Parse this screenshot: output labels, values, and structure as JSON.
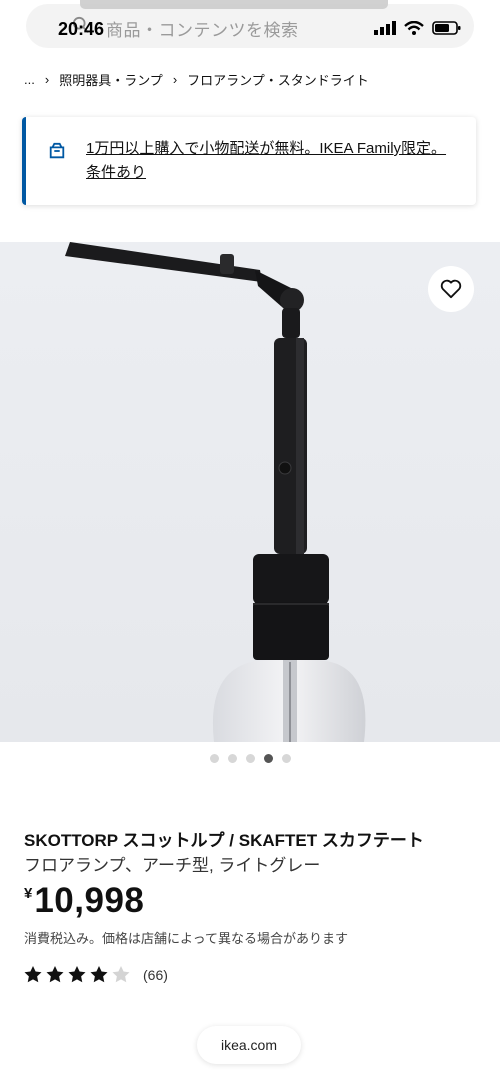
{
  "status_bar": {
    "time": "20:46"
  },
  "search": {
    "placeholder": "商品・コンテンツを検索"
  },
  "breadcrumb": {
    "ellipsis": "...",
    "items": [
      "照明器具・ランプ",
      "フロアランプ・スタンドライト"
    ]
  },
  "banner": {
    "text": "1万円以上購入で小物配送が無料。IKEA Family限定。条件あり"
  },
  "gallery": {
    "dots": 5,
    "active_index": 3
  },
  "product": {
    "name": "SKOTTORP スコットルプ / SKAFTET スカフテート",
    "description": "フロアランプ、アーチ型, ライトグレー",
    "currency": "¥",
    "price": "10,998",
    "tax_note": "消費税込み。価格は店舗によって異なる場合があります",
    "rating": {
      "stars_filled": 4,
      "stars_total": 5,
      "count": "(66)"
    }
  },
  "browser": {
    "domain": "ikea.com"
  },
  "colors": {
    "accent": "#0058a3",
    "text": "#111111"
  },
  "icons": [
    "search-icon",
    "signal-icon",
    "wifi-icon",
    "battery-icon",
    "truck-icon",
    "heart-icon",
    "star-icon"
  ]
}
